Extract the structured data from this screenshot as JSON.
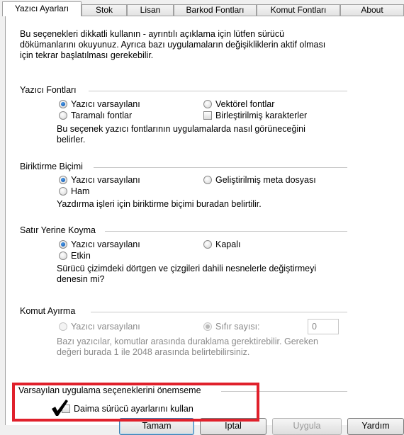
{
  "tabs": [
    "Yazıcı Ayarları",
    "Stok",
    "Lisan",
    "Barkod Fontları",
    "Komut Fontları",
    "About"
  ],
  "intro": [
    "Bu seçenekleri dikkatli kullanın - ayrıntılı açıklama için lütfen sürücü",
    "dökümanlarını okuyunuz. Ayrıca bazı uygulamaların değişikliklerin aktif olması",
    "için tekrar başlatılması gerekebilir."
  ],
  "printer_fonts": {
    "title": "Yazıcı Fontları",
    "opt_default": "Yazıcı varsayılanı",
    "opt_vector": "Vektörel fontlar",
    "opt_raster": "Taramalı fontlar",
    "opt_merged": "Birleştirilmiş karakterler",
    "desc": [
      "Bu seçenek yazıcı fontlarının uygulamalarda nasıl görüneceğini",
      "belirler."
    ]
  },
  "spool": {
    "title": "Biriktirme Biçimi",
    "opt_default": "Yazıcı varsayılanı",
    "opt_enhanced": "Geliştirilmiş meta dosyası",
    "opt_raw": "Ham",
    "desc": "Yazdırma işleri için biriktirme biçimi buradan belirtilir."
  },
  "substitution": {
    "title": "Satır Yerine Koyma",
    "opt_default": "Yazıcı varsayılanı",
    "opt_off": "Kapalı",
    "opt_on": "Etkin",
    "desc": [
      "Sürücü çizimdeki dörtgen ve çizgileri dahili nesnelerle değiştirmeyi",
      "denesin mi?"
    ]
  },
  "command_sep": {
    "title": "Komut Ayırma",
    "opt_default": "Yazıcı varsayılanı",
    "opt_zero": "Sıfır sayısı:",
    "count_value": "0",
    "desc": [
      "Bazı yazıcılar, komutlar arasında duraklama gerektirebilir. Gereken",
      "değeri burada 1 ile 2048 arasında belirtebilirsiniz."
    ]
  },
  "ignore_defaults": {
    "title": "Varsayılan uygulama seçeneklerini önemseme",
    "check_label": "Daima sürücü ayarlarını kullan"
  },
  "buttons": [
    "Tamam",
    "İptal",
    "Uygula",
    "Yardım"
  ],
  "colors": {
    "highlight": "#e0202b",
    "radio_selected": "#0b4fa8"
  }
}
